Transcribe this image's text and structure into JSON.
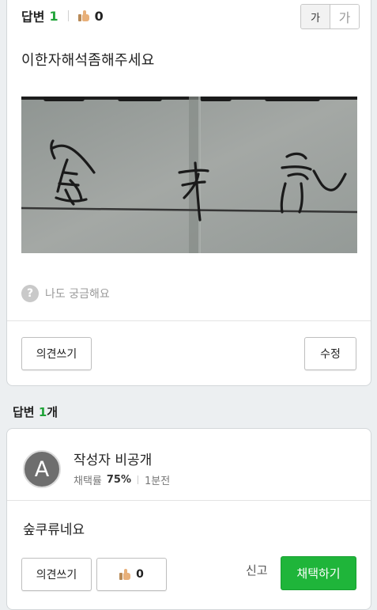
{
  "question": {
    "header_label": "답변",
    "answer_count": "1",
    "like_count": "0",
    "font_toggle": {
      "small": "가",
      "large": "가"
    },
    "title": "이한자해석좀해주세요",
    "curious_label": "나도 궁금해요",
    "comment_button": "의견쓰기",
    "edit_button": "수정"
  },
  "answers_section": {
    "label": "답변",
    "count": "1",
    "suffix": "개"
  },
  "answer": {
    "avatar_letter": "A",
    "author": "작성자 비공개",
    "adoption_label": "채택률",
    "adoption_rate": "75%",
    "time": "1분전",
    "text": "숲쿠류네요",
    "comment_button": "의견쓰기",
    "like_count": "0",
    "report_label": "신고",
    "adopt_button": "채택하기"
  },
  "colors": {
    "accent_green": "#1fa338",
    "adopt_button": "#1fb53a",
    "background": "#eceff1"
  }
}
